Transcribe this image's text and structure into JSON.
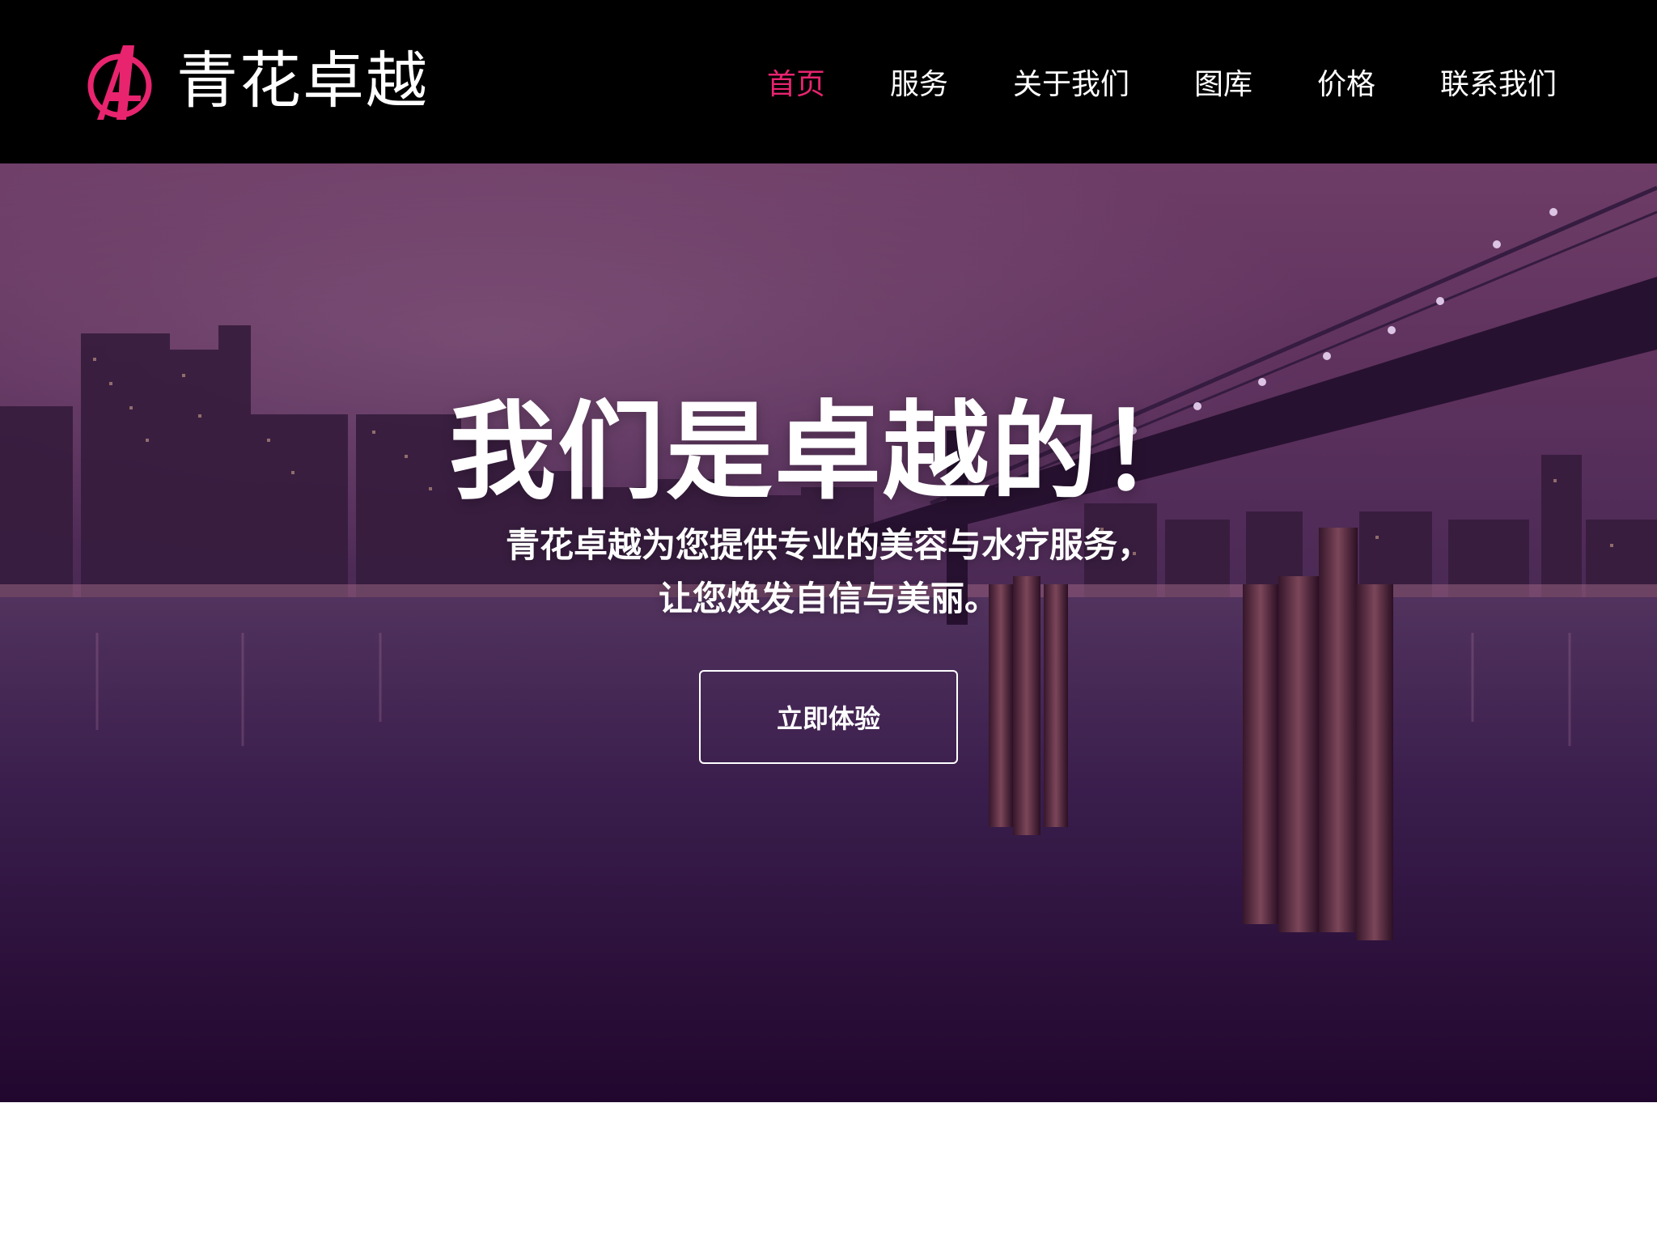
{
  "brand": {
    "logo_icon": "avengers-a-logo",
    "name": "青花卓越",
    "accent_color": "#e8246f"
  },
  "nav": {
    "items": [
      {
        "label": "首页",
        "active": true
      },
      {
        "label": "服务",
        "active": false
      },
      {
        "label": "关于我们",
        "active": false
      },
      {
        "label": "图库",
        "active": false
      },
      {
        "label": "价格",
        "active": false
      },
      {
        "label": "联系我们",
        "active": false
      }
    ]
  },
  "hero": {
    "title": "我们是卓越的！",
    "subtitle_line1": "青花卓越为您提供专业的美容与水疗服务，",
    "subtitle_line2": "让您焕发自信与美丽。",
    "cta_label": "立即体验",
    "background": "night-city-bridge-waterfront-photo"
  }
}
